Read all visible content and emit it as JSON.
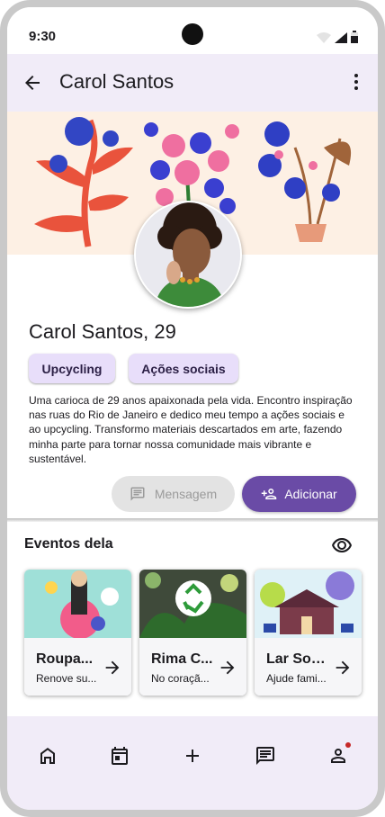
{
  "status_bar": {
    "time": "9:30"
  },
  "app_bar": {
    "title": "Carol Santos"
  },
  "profile": {
    "name_age": "Carol Santos, 29",
    "tags": [
      "Upcycling",
      "Ações sociais"
    ],
    "bio": "Uma carioca de 29 anos apaixonada pela vida. Encontro inspiração nas ruas do Rio de Janeiro e dedico meu tempo a ações sociais e ao upcycling. Transformo materiais descartados em arte, fazendo minha parte para tornar nossa comunidade mais vibrante e sustentável."
  },
  "actions": {
    "message_label": "Mensagem",
    "add_label": "Adicionar"
  },
  "events": {
    "title": "Eventos dela",
    "items": [
      {
        "title": "Roupa...",
        "subtitle": "Renove su..."
      },
      {
        "title": "Rima C...",
        "subtitle": "No coraçã..."
      },
      {
        "title": "Lar Soli...",
        "subtitle": "Ajude fami..."
      }
    ]
  },
  "colors": {
    "primary": "#6a4ba6",
    "chip": "#e8defa",
    "surface_tint": "#f1ecf8",
    "cover_bg": "#fdf0e4"
  },
  "icons": {
    "app_bar": [
      "arrow-back-icon",
      "more-vert-icon"
    ],
    "actions": [
      "message-icon",
      "person-add-icon"
    ],
    "events": [
      "visibility-icon",
      "arrow-forward-icon"
    ],
    "nav": [
      "home-icon",
      "calendar-icon",
      "add-icon",
      "chat-icon",
      "profile-icon"
    ]
  }
}
